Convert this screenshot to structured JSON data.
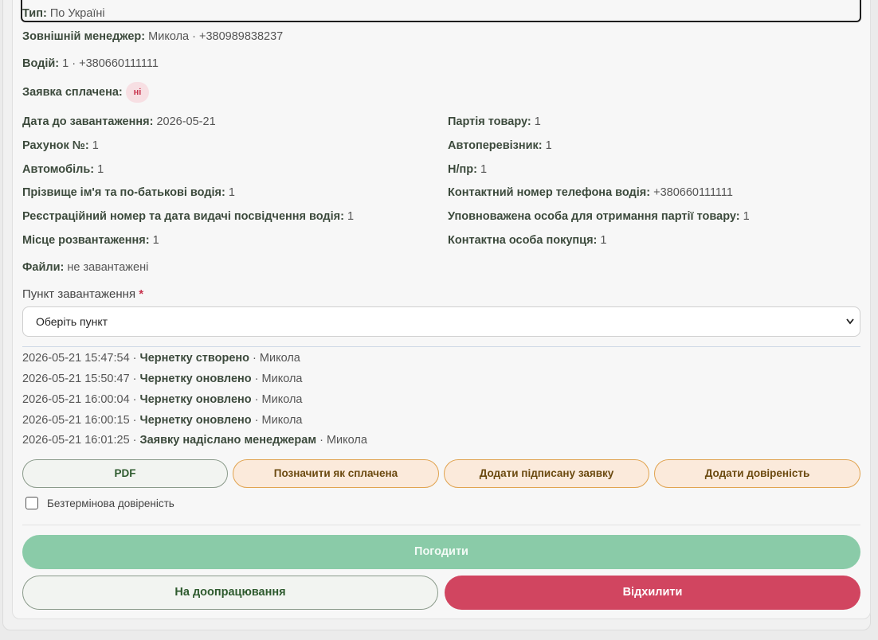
{
  "type": {
    "label": "Тип:",
    "value": "По Україні"
  },
  "external_manager": {
    "label": "Зовнішній менеджер:",
    "value": "Микола · +380989838237"
  },
  "driver": {
    "label": "Водій:",
    "value": "1 · +380660111111"
  },
  "paid": {
    "label": "Заявка сплачена:",
    "badge": "ні"
  },
  "fields_left": [
    {
      "label": "Дата до завантаження:",
      "value": "2026-05-21"
    },
    {
      "label": "Рахунок №:",
      "value": "1"
    },
    {
      "label": "Автомобіль:",
      "value": "1"
    },
    {
      "label": "Прізвище ім'я та по-батькові водія:",
      "value": "1"
    },
    {
      "label": "Реєстраційний номер та дата видачі посвідчення водія:",
      "value": "1"
    },
    {
      "label": "Місце розвантаження:",
      "value": "1"
    }
  ],
  "fields_right": [
    {
      "label": "Партія товару:",
      "value": "1"
    },
    {
      "label": "Автоперевізник:",
      "value": "1"
    },
    {
      "label": "Н/пр:",
      "value": "1"
    },
    {
      "label": "Контактний номер телефона водія:",
      "value": "+380660111111"
    },
    {
      "label": "Уповноважена особа для отримання партії товару:",
      "value": "1"
    },
    {
      "label": "Контактна особа покупця:",
      "value": "1"
    }
  ],
  "files": {
    "label": "Файли:",
    "value": "не завантажені"
  },
  "loading_point": {
    "label": "Пункт завантаження",
    "required_mark": "*",
    "selected": "Оберіть пункт"
  },
  "history": [
    {
      "time": "2026-05-21 15:47:54 ·",
      "action": "Чернетку створено",
      "user": "· Микола"
    },
    {
      "time": "2026-05-21 15:50:47 ·",
      "action": "Чернетку оновлено",
      "user": "· Микола"
    },
    {
      "time": "2026-05-21 16:00:04 ·",
      "action": "Чернетку оновлено",
      "user": "· Микола"
    },
    {
      "time": "2026-05-21 16:00:15 ·",
      "action": "Чернетку оновлено",
      "user": "· Микола"
    },
    {
      "time": "2026-05-21 16:01:25 ·",
      "action": "Заявку надіслано менеджерам",
      "user": "· Микола"
    }
  ],
  "actions": {
    "pdf": "PDF",
    "mark_paid": "Позначити як сплачена",
    "add_signed": "Додати підписану заявку",
    "add_poa": "Додати довіреність"
  },
  "indefinite_poa": {
    "label": "Безтермінова довіреність",
    "checked": false
  },
  "footer": {
    "approve": "Погодити",
    "rework": "На доопрацювання",
    "reject": "Відхилити"
  },
  "colors": {
    "approve": "#8acba8",
    "reject": "#d14560",
    "badge_bg": "#f7dfe3",
    "accent_orange": "#e0a34f"
  }
}
